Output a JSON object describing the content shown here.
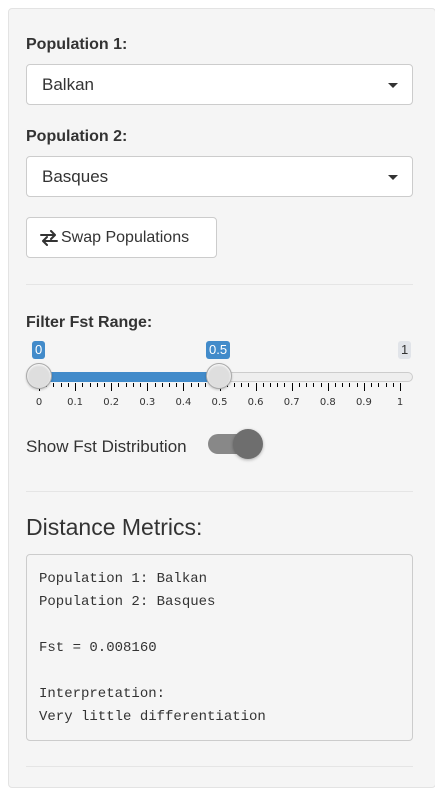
{
  "sidebar": {
    "population1": {
      "label": "Population 1:",
      "selected": "Balkan"
    },
    "population2": {
      "label": "Population 2:",
      "selected": "Basques"
    },
    "swap_button": {
      "label": "Swap Populations",
      "icon": "exchange-icon"
    },
    "fst_filter": {
      "label": "Filter Fst Range:",
      "min": 0,
      "max": 1,
      "step": 0.1,
      "from": 0,
      "to": 0.5,
      "from_label": "0",
      "to_label": "0.5",
      "max_label": "1",
      "grid_labels": [
        "0",
        "0.1",
        "0.2",
        "0.3",
        "0.4",
        "0.5",
        "0.6",
        "0.7",
        "0.8",
        "0.9",
        "1"
      ],
      "active_color": "#428bca"
    },
    "distribution_toggle": {
      "label": "Show Fst Distribution",
      "checked": true
    },
    "metrics": {
      "heading": "Distance Metrics:",
      "output": "Population 1: Balkan\nPopulation 2: Basques\n\nFst = 0.008160\n\nInterpretation:\nVery little differentiation"
    }
  }
}
